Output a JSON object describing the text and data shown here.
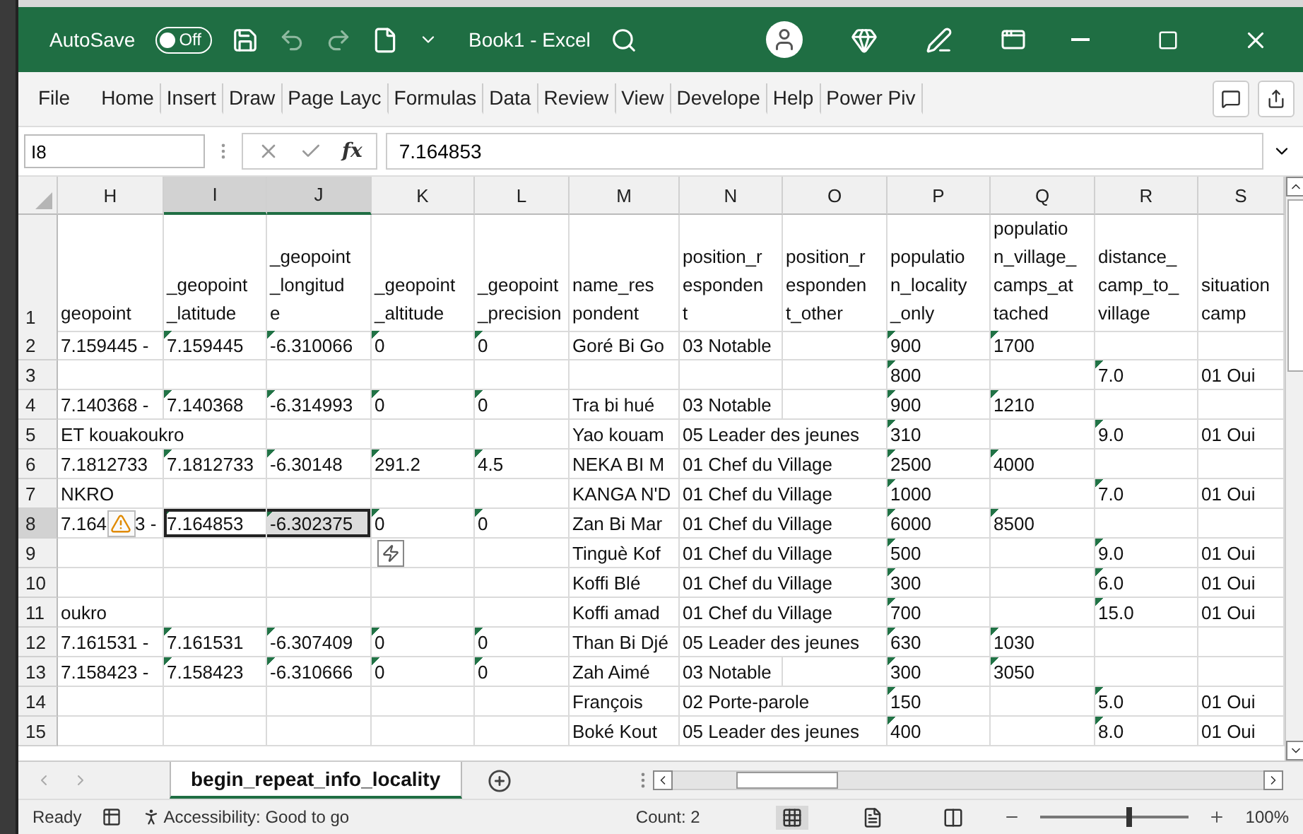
{
  "title_bar": {
    "autosave_label": "AutoSave",
    "autosave_on": false,
    "autosave_state": "Off",
    "title": "Book1  -  Excel"
  },
  "ribbon_tabs": [
    {
      "label": "File",
      "selected": false
    },
    {
      "label": "Home",
      "selected": false
    },
    {
      "label": "Insert",
      "selected": false
    },
    {
      "label": "Draw",
      "selected": false
    },
    {
      "label": "Page Layc",
      "selected": false
    },
    {
      "label": "Formulas",
      "selected": false
    },
    {
      "label": "Data",
      "selected": false
    },
    {
      "label": "Review",
      "selected": false
    },
    {
      "label": "View",
      "selected": false
    },
    {
      "label": "Develope",
      "selected": false
    },
    {
      "label": "Help",
      "selected": false
    },
    {
      "label": "Power Piv",
      "selected": false
    }
  ],
  "formula_bar": {
    "name_box": "I8",
    "function_label": "fx",
    "value": "7.164853"
  },
  "columns": [
    {
      "letter": "H",
      "selected": false
    },
    {
      "letter": "I",
      "selected": true
    },
    {
      "letter": "J",
      "selected": true
    },
    {
      "letter": "K",
      "selected": false
    },
    {
      "letter": "L",
      "selected": false
    },
    {
      "letter": "M",
      "selected": false
    },
    {
      "letter": "N",
      "selected": false
    },
    {
      "letter": "O",
      "selected": false
    },
    {
      "letter": "P",
      "selected": false
    },
    {
      "letter": "Q",
      "selected": false
    },
    {
      "letter": "R",
      "selected": false
    },
    {
      "letter": "S",
      "selected": false
    }
  ],
  "header_row": {
    "num": "1",
    "cells": [
      [
        "geopoint"
      ],
      [
        "_geopoint",
        "_latitude"
      ],
      [
        "_geopoint",
        "_longitud",
        "e"
      ],
      [
        "_geopoint",
        "_altitude"
      ],
      [
        "_geopoint",
        "_precision"
      ],
      [
        "name_res",
        "pondent"
      ],
      [
        "position_r",
        "esponden",
        "t"
      ],
      [
        "position_r",
        "esponden",
        "t_other"
      ],
      [
        "populatio",
        "n_locality",
        "_only"
      ],
      [
        "populatio",
        "n_village_",
        "camps_at",
        "tached"
      ],
      [
        "distance_",
        "camp_to_",
        "village"
      ],
      [
        "situation",
        "camp"
      ]
    ]
  },
  "rows": [
    {
      "num": "2",
      "selected": false,
      "cells": [
        {
          "text": "7.159445 -",
          "flagged": false
        },
        {
          "text": "7.159445",
          "flagged": true
        },
        {
          "text": "-6.310066",
          "flagged": true
        },
        {
          "text": "0",
          "flagged": true
        },
        {
          "text": "0",
          "flagged": true
        },
        {
          "text": "Goré Bi Go",
          "flagged": false
        },
        {
          "text": "03 Notable",
          "flagged": false
        },
        null,
        {
          "text": "900",
          "flagged": true
        },
        {
          "text": "1700",
          "flagged": true
        },
        null,
        null
      ]
    },
    {
      "num": "3",
      "selected": false,
      "cells": [
        null,
        null,
        null,
        null,
        null,
        null,
        null,
        null,
        {
          "text": "800",
          "flagged": true
        },
        null,
        {
          "text": "7.0",
          "flagged": true
        },
        {
          "text": "01 Oui",
          "flagged": false
        }
      ]
    },
    {
      "num": "4",
      "selected": false,
      "cells": [
        {
          "text": "7.140368 -",
          "flagged": false
        },
        {
          "text": "7.140368",
          "flagged": true
        },
        {
          "text": "-6.314993",
          "flagged": true
        },
        {
          "text": "0",
          "flagged": true
        },
        {
          "text": "0",
          "flagged": true
        },
        {
          "text": "Tra bi hué",
          "flagged": false
        },
        {
          "text": "03 Notable",
          "flagged": false
        },
        null,
        {
          "text": "900",
          "flagged": true
        },
        {
          "text": "1210",
          "flagged": true
        },
        null,
        null
      ]
    },
    {
      "num": "5",
      "selected": false,
      "cells": [
        {
          "text": "ET kouakoukro",
          "flagged": false
        },
        null,
        null,
        null,
        null,
        {
          "text": "Yao kouam",
          "flagged": false
        },
        {
          "text": "05 Leader des jeunes",
          "flagged": false
        },
        null,
        {
          "text": "310",
          "flagged": true
        },
        null,
        {
          "text": "9.0",
          "flagged": true
        },
        {
          "text": "01 Oui",
          "flagged": false
        }
      ]
    },
    {
      "num": "6",
      "selected": false,
      "cells": [
        {
          "text": "7.1812733",
          "flagged": false
        },
        {
          "text": "7.1812733",
          "flagged": true
        },
        {
          "text": "-6.30148",
          "flagged": true
        },
        {
          "text": "291.2",
          "flagged": true
        },
        {
          "text": "4.5",
          "flagged": true
        },
        {
          "text": "NEKA BI M",
          "flagged": false
        },
        {
          "text": "01 Chef du Village",
          "flagged": false
        },
        null,
        {
          "text": "2500",
          "flagged": true
        },
        {
          "text": "4000",
          "flagged": true
        },
        null,
        null
      ]
    },
    {
      "num": "7",
      "selected": false,
      "cells": [
        {
          "text": "NKRO",
          "flagged": false
        },
        null,
        null,
        null,
        null,
        {
          "text": "KANGA N'D",
          "flagged": false
        },
        {
          "text": "01 Chef du Village",
          "flagged": false
        },
        null,
        {
          "text": "1000",
          "flagged": true
        },
        null,
        {
          "text": "7.0",
          "flagged": true
        },
        {
          "text": "01 Oui",
          "flagged": false
        }
      ]
    },
    {
      "num": "8",
      "selected": true,
      "error_tag": {
        "before": "7.164",
        "after": "3 -"
      },
      "cells": [
        null,
        {
          "text": "7.164853",
          "flagged": true
        },
        {
          "text": "-6.302375",
          "flagged": true
        },
        {
          "text": "0",
          "flagged": true
        },
        {
          "text": "0",
          "flagged": true
        },
        {
          "text": "Zan Bi Mar",
          "flagged": false
        },
        {
          "text": "01 Chef du Village",
          "flagged": false
        },
        null,
        {
          "text": "6000",
          "flagged": true
        },
        {
          "text": "8500",
          "flagged": true
        },
        null,
        null
      ]
    },
    {
      "num": "9",
      "selected": false,
      "quick_analysis": true,
      "cells": [
        null,
        null,
        null,
        null,
        null,
        {
          "text": "Tinguè Kof",
          "flagged": false
        },
        {
          "text": "01 Chef du Village",
          "flagged": false
        },
        null,
        {
          "text": "500",
          "flagged": true
        },
        null,
        {
          "text": "9.0",
          "flagged": true
        },
        {
          "text": "01 Oui",
          "flagged": false
        }
      ]
    },
    {
      "num": "10",
      "selected": false,
      "cells": [
        null,
        null,
        null,
        null,
        null,
        {
          "text": "Koffi Blé",
          "flagged": false
        },
        {
          "text": "01 Chef du Village",
          "flagged": false
        },
        null,
        {
          "text": "300",
          "flagged": true
        },
        null,
        {
          "text": "6.0",
          "flagged": true
        },
        {
          "text": "01 Oui",
          "flagged": false
        }
      ]
    },
    {
      "num": "11",
      "selected": false,
      "cells": [
        {
          "text": "oukro",
          "flagged": false
        },
        null,
        null,
        null,
        null,
        {
          "text": "Koffi amad",
          "flagged": false
        },
        {
          "text": "01 Chef du Village",
          "flagged": false
        },
        null,
        {
          "text": "700",
          "flagged": true
        },
        null,
        {
          "text": "15.0",
          "flagged": true
        },
        {
          "text": "01 Oui",
          "flagged": false
        }
      ]
    },
    {
      "num": "12",
      "selected": false,
      "cells": [
        {
          "text": "7.161531 -",
          "flagged": false
        },
        {
          "text": "7.161531",
          "flagged": true
        },
        {
          "text": "-6.307409",
          "flagged": true
        },
        {
          "text": "0",
          "flagged": true
        },
        {
          "text": "0",
          "flagged": true
        },
        {
          "text": "Than Bi Djé",
          "flagged": false
        },
        {
          "text": "05 Leader des jeunes",
          "flagged": false
        },
        null,
        {
          "text": "630",
          "flagged": true
        },
        {
          "text": "1030",
          "flagged": true
        },
        null,
        null
      ]
    },
    {
      "num": "13",
      "selected": false,
      "cells": [
        {
          "text": "7.158423 -",
          "flagged": false
        },
        {
          "text": "7.158423",
          "flagged": true
        },
        {
          "text": "-6.310666",
          "flagged": true
        },
        {
          "text": "0",
          "flagged": true
        },
        {
          "text": "0",
          "flagged": true
        },
        {
          "text": "Zah Aimé",
          "flagged": false
        },
        {
          "text": "03 Notable",
          "flagged": false
        },
        null,
        {
          "text": "300",
          "flagged": true
        },
        {
          "text": "3050",
          "flagged": true
        },
        null,
        null
      ]
    },
    {
      "num": "14",
      "selected": false,
      "cells": [
        null,
        null,
        null,
        null,
        null,
        {
          "text": "François",
          "flagged": false
        },
        {
          "text": "02 Porte-parole",
          "flagged": false
        },
        null,
        {
          "text": "150",
          "flagged": true
        },
        null,
        {
          "text": "5.0",
          "flagged": true
        },
        {
          "text": "01 Oui",
          "flagged": false
        }
      ]
    },
    {
      "num": "15",
      "selected": false,
      "cells": [
        null,
        null,
        null,
        null,
        null,
        {
          "text": "Boké Kout",
          "flagged": false
        },
        {
          "text": "05 Leader des jeunes",
          "flagged": false
        },
        null,
        {
          "text": "400",
          "flagged": true
        },
        null,
        {
          "text": "8.0",
          "flagged": true
        },
        {
          "text": "01 Oui",
          "flagged": false
        }
      ]
    }
  ],
  "sheet_tabs": [
    {
      "label": "begin_repeat_info_locality",
      "selected": true
    }
  ],
  "status_bar": {
    "state": "Ready",
    "accessibility": "Accessibility: Good to go",
    "count": "Count: 2",
    "views": [
      {
        "kind": "normal",
        "selected": true
      },
      {
        "kind": "page-layout",
        "selected": false
      },
      {
        "kind": "page-break",
        "selected": false
      }
    ],
    "zoom": {
      "level": 0.6,
      "reading": "100%"
    }
  }
}
